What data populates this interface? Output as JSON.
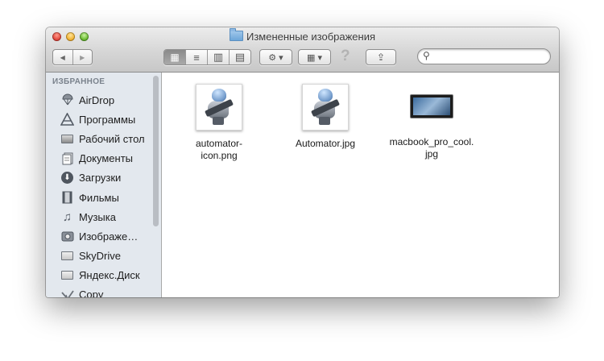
{
  "window": {
    "title": "Измененные изображения",
    "title_icon": "folder-icon"
  },
  "toolbar": {
    "nav": {
      "back_icon": "◀",
      "forward_icon": "▶"
    },
    "view_modes": [
      {
        "icon": "▦",
        "name": "icon-view",
        "active": true
      },
      {
        "icon": "≡",
        "name": "list-view",
        "active": false
      },
      {
        "icon": "▥",
        "name": "column-view",
        "active": false
      },
      {
        "icon": "▤",
        "name": "coverflow-view",
        "active": false
      }
    ],
    "action_icon": "⚙ ▾",
    "arrange_icon": "▦ ▾",
    "help_icon": "?",
    "share_icon": "⇪",
    "search": {
      "placeholder": "",
      "value": "",
      "icon": "⚲"
    }
  },
  "sidebar": {
    "section": "ИЗБРАННОЕ",
    "items": [
      {
        "label": "AirDrop",
        "icon": "airdrop-icon"
      },
      {
        "label": "Программы",
        "icon": "applications-icon"
      },
      {
        "label": "Рабочий стол",
        "icon": "desktop-icon"
      },
      {
        "label": "Документы",
        "icon": "documents-icon"
      },
      {
        "label": "Загрузки",
        "icon": "downloads-icon"
      },
      {
        "label": "Фильмы",
        "icon": "movies-icon"
      },
      {
        "label": "Музыка",
        "icon": "music-icon"
      },
      {
        "label": "Изображе…",
        "icon": "pictures-icon"
      },
      {
        "label": "SkyDrive",
        "icon": "folder-icon"
      },
      {
        "label": "Яндекс.Диск",
        "icon": "folder-icon"
      },
      {
        "label": "Copy",
        "icon": "copy-icon"
      }
    ]
  },
  "files": [
    {
      "name_line1": "automator-",
      "name_line2": "icon.png",
      "kind": "automator"
    },
    {
      "name_line1": "Automator.jpg",
      "name_line2": "",
      "kind": "automator"
    },
    {
      "name_line1": "macbook_pro_cool.",
      "name_line2": "jpg",
      "kind": "laptop"
    }
  ]
}
